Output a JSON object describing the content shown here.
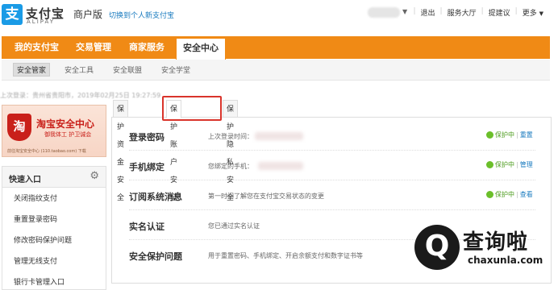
{
  "header": {
    "logo_glyph": "支",
    "logo_cn": "支付宝",
    "logo_en": "ALIPAY",
    "merchant_label": "商户版",
    "switch_link": "切换到个人新支付宝",
    "caret": "▼",
    "links": [
      "退出",
      "服务大厅",
      "提建议",
      "更多"
    ],
    "more_caret": "▼"
  },
  "main_nav": {
    "tabs": [
      "我的支付宝",
      "交易管理",
      "商家服务",
      "安全中心"
    ],
    "active_index": 3,
    "accent": "#f08a15"
  },
  "sub_nav": {
    "items": [
      "安全管家",
      "安全工具",
      "安全联盟",
      "安全学堂"
    ],
    "active_index": 0
  },
  "last_login": "上次登录：贵州省贵阳市，2019年02月25日 19:27:59",
  "banner": {
    "shield_glyph": "淘",
    "title": "淘宝安全中心",
    "subtitle": "御我体工  护卫诚会",
    "footer": "前往淘宝安全中心 (110.taobao.com) 下载"
  },
  "quick_entry": {
    "title": "快速入口",
    "gear_icon": "gear-icon",
    "items": [
      "关闭指纹支付",
      "重置登录密码",
      "修改密码保护问题",
      "管理无线支付",
      "银行卡管理入口"
    ]
  },
  "content_tabs": {
    "tabs": [
      "保护资金安全",
      "保护账户安全",
      "保护隐私安全"
    ],
    "active_index": 1,
    "highlight_color": "#d9342b"
  },
  "rows": [
    {
      "label": "登录密码",
      "desc": "上次登录时间：",
      "status": "保护中",
      "action": "重置"
    },
    {
      "label": "手机绑定",
      "desc": "您绑定的手机：",
      "status": "保护中",
      "action": "管理"
    },
    {
      "label": "订阅系统消息",
      "desc": "第一时间了解您在支付宝交易状态的变更",
      "status": "保护中",
      "action": "查看"
    },
    {
      "label": "实名认证",
      "desc": "您已通过实名认证",
      "status": "",
      "action": ""
    },
    {
      "label": "安全保护问题",
      "desc": "用于重置密码、手机绑定、开启余额支付和数字证书等",
      "status": "",
      "action": ""
    }
  ],
  "watermark": {
    "glyph": "Q",
    "title": "查询啦",
    "domain": "chaxunla.com"
  }
}
